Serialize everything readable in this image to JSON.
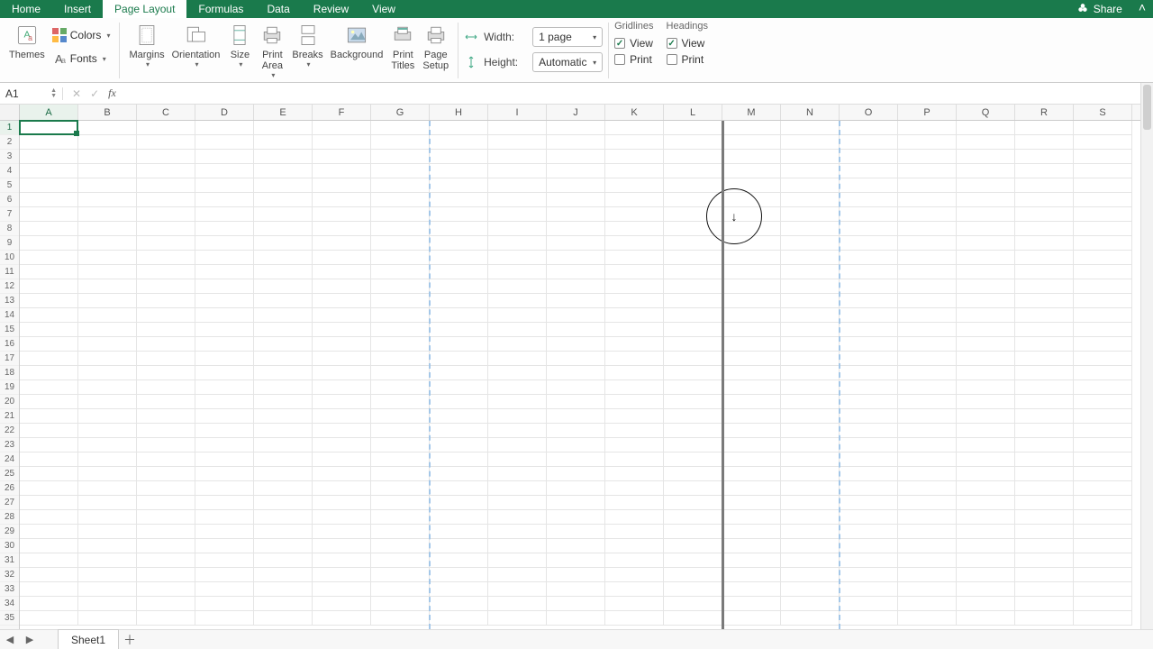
{
  "tabs": {
    "home": "Home",
    "insert": "Insert",
    "pagelayout": "Page Layout",
    "formulas": "Formulas",
    "data": "Data",
    "review": "Review",
    "view": "View"
  },
  "active_tab": "pagelayout",
  "share": "Share",
  "ribbon": {
    "themes": "Themes",
    "colors": "Colors",
    "fonts": "Fonts",
    "margins": "Margins",
    "orientation": "Orientation",
    "size": "Size",
    "print_area": "Print\nArea",
    "breaks": "Breaks",
    "background": "Background",
    "print_titles": "Print\nTitles",
    "page_setup": "Page\nSetup"
  },
  "scale": {
    "width_label": "Width:",
    "height_label": "Height:",
    "width_value": "1 page",
    "height_value": "Automatic"
  },
  "options": {
    "gridlines_title": "Gridlines",
    "headings_title": "Headings",
    "view_label": "View",
    "print_label": "Print",
    "gridlines_view": true,
    "gridlines_print": false,
    "headings_view": true,
    "headings_print": false
  },
  "namebox": "A1",
  "fx": "fx",
  "formula_value": "",
  "columns": [
    "A",
    "B",
    "C",
    "D",
    "E",
    "F",
    "G",
    "H",
    "I",
    "J",
    "K",
    "L",
    "M",
    "N",
    "O",
    "P",
    "Q",
    "R",
    "S"
  ],
  "rows": 35,
  "active_cell": {
    "col": "A",
    "row": 1
  },
  "sheet_name": "Sheet1",
  "page_break_dashed_after_cols": [
    "G",
    "N"
  ],
  "page_break_solid_after_col": "L"
}
